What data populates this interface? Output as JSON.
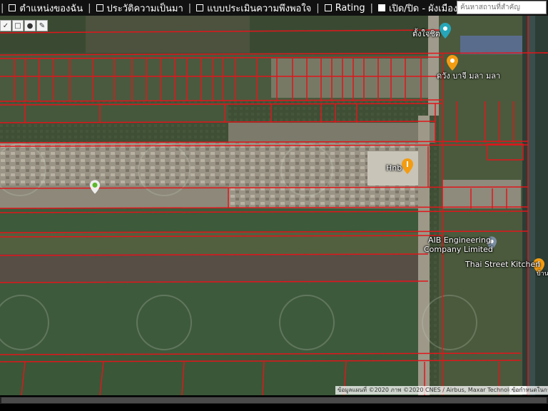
{
  "nav": {
    "items": [
      {
        "label": "ตำแหน่งของฉัน"
      },
      {
        "label": "ประวัติความเป็นมา"
      },
      {
        "label": "แบบประเมินความพึงพอใจ"
      },
      {
        "label": "Rating"
      },
      {
        "label": "เปิด/ปิด - ผังเมือง"
      }
    ],
    "separator": "|"
  },
  "search": {
    "placeholder": "ค้นหาสถานที่สำคัญ"
  },
  "toolbar": {
    "icons": [
      "check-icon",
      "square-icon",
      "circle-icon",
      "pen-icon"
    ]
  },
  "map": {
    "labels": {
      "place_1": "ตั้งใจชิต",
      "place_2": "ดวัง บาจี มลา มลา",
      "hnb": "Hnb",
      "aib": "AIB Engineering Company Limited",
      "aib_line1": "AIB Engineering",
      "aib_line2": "Company Limited",
      "thai_street": "Thai Street Kitchen",
      "thai_street_suffix": "บ้าน"
    },
    "parcel_color": "#e0161b",
    "attribution": "ข้อมูลแผนที่ ©2020 ภาพ ©2020 CNES / Airbus, Maxar Technologies",
    "terms": "ข้อกำหนดในการใช้"
  }
}
